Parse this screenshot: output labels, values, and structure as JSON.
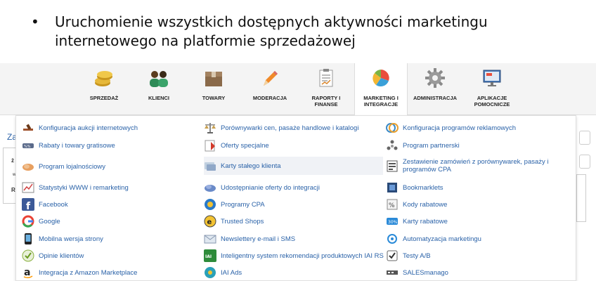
{
  "slide": {
    "bullet": "•",
    "text": "Uruchomienie wszystkich dostępnych aktywności marketingu internetowego na platformie sprzedażowej"
  },
  "nav": {
    "items": [
      {
        "label": "SPRZEDAŻ",
        "icon": "coins-icon"
      },
      {
        "label": "KLIENCI",
        "icon": "people-icon"
      },
      {
        "label": "TOWARY",
        "icon": "box-icon"
      },
      {
        "label": "MODERACJA",
        "icon": "pencil-icon"
      },
      {
        "label": "RAPORTY I FINANSE",
        "icon": "report-icon"
      },
      {
        "label": "MARKETING I INTEGRACJE",
        "icon": "pie-chart-icon",
        "active": true
      },
      {
        "label": "ADMINISTRACJA",
        "icon": "gear-icon"
      },
      {
        "label": "APLIKACJE POMOCNICZE",
        "icon": "monitor-icon"
      }
    ]
  },
  "background": {
    "left_link": "Za",
    "left_a": "ż",
    "left_b": "w",
    "left_c": "R"
  },
  "menu": {
    "col1": [
      "Konfiguracja aukcji internetowych",
      "Rabaty i towary gratisowe",
      "Program lojalnościowy",
      "Statystyki WWW i remarketing",
      "Facebook",
      "Google",
      "Mobilna wersja strony",
      "Opinie klientów",
      "Integracja z Amazon Marketplace"
    ],
    "col2": [
      "Porównywarki cen, pasaże handlowe i katalogi",
      "Oferty specjalne",
      "Karty stałego klienta",
      "Udostępnianie oferty do integracji",
      "Programy CPA",
      "Trusted Shops",
      "Newslettery e-mail i SMS",
      "Inteligentny system rekomendacji produktowych IAI RS",
      "IAI Ads"
    ],
    "col3": [
      "Konfiguracja programów reklamowych",
      "Program partnerski",
      "Zestawienie zamówień z porównywarek, pasaży i programów CPA",
      "Bookmarklets",
      "Kody rabatowe",
      "Karty rabatowe",
      "Automatyzacja marketingu",
      "Testy A/B",
      "SALESmanago"
    ]
  },
  "colors": {
    "link": "#2a62a8",
    "nav_bg": "#f4f4f4"
  }
}
